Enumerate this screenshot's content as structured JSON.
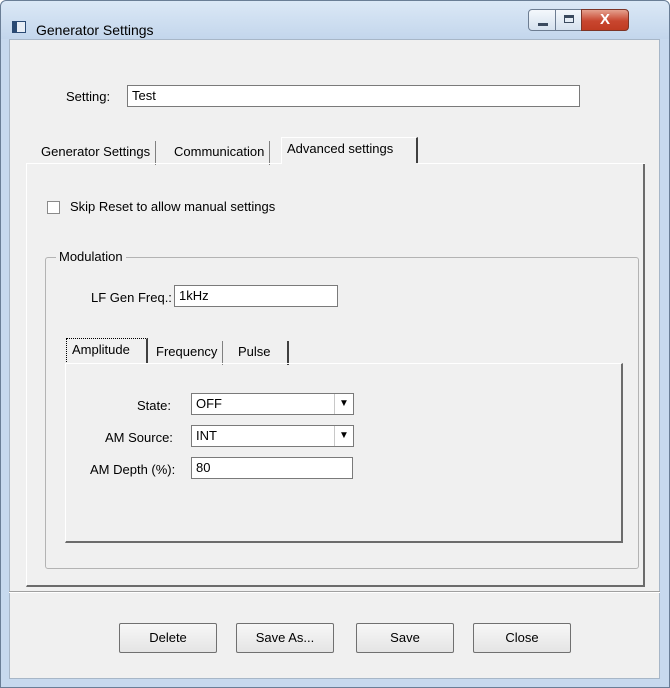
{
  "window": {
    "title": "Generator Settings",
    "close_glyph": "X"
  },
  "setting": {
    "label": "Setting:",
    "value": "Test"
  },
  "tabs": [
    {
      "label": "Generator Settings"
    },
    {
      "label": "Communication"
    },
    {
      "label": "Advanced settings"
    }
  ],
  "advanced": {
    "skip_reset_label": "Skip Reset to allow manual settings",
    "skip_reset_checked": false,
    "modulation": {
      "title": "Modulation",
      "lf_gen_freq_label": "LF Gen Freq.:",
      "lf_gen_freq_value": "1kHz",
      "subtabs": [
        {
          "label": "Amplitude"
        },
        {
          "label": "Frequency"
        },
        {
          "label": "Pulse"
        }
      ],
      "amplitude": {
        "state_label": "State:",
        "state_value": "OFF",
        "am_source_label": "AM Source:",
        "am_source_value": "INT",
        "am_depth_label": "AM Depth (%):",
        "am_depth_value": "80"
      }
    }
  },
  "buttons": {
    "delete": "Delete",
    "save_as": "Save As...",
    "save": "Save",
    "close": "Close"
  },
  "icons": [
    "app-icon",
    "minimize-icon",
    "maximize-icon",
    "close-icon",
    "dropdown-arrow-icon"
  ]
}
